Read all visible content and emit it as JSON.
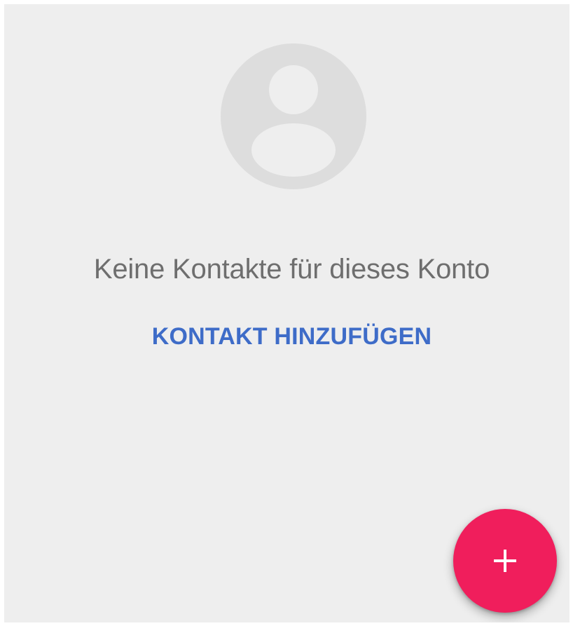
{
  "empty_state": {
    "message": "Keine Kontakte für dieses Konto",
    "action_label": "KONTAKT HINZUFÜGEN",
    "avatar_icon": "person-placeholder-icon"
  },
  "fab": {
    "icon": "plus-icon",
    "color": "#f01e5c"
  },
  "colors": {
    "background": "#eeeeee",
    "accent": "#3e6cc8",
    "placeholder": "#dddddd"
  }
}
